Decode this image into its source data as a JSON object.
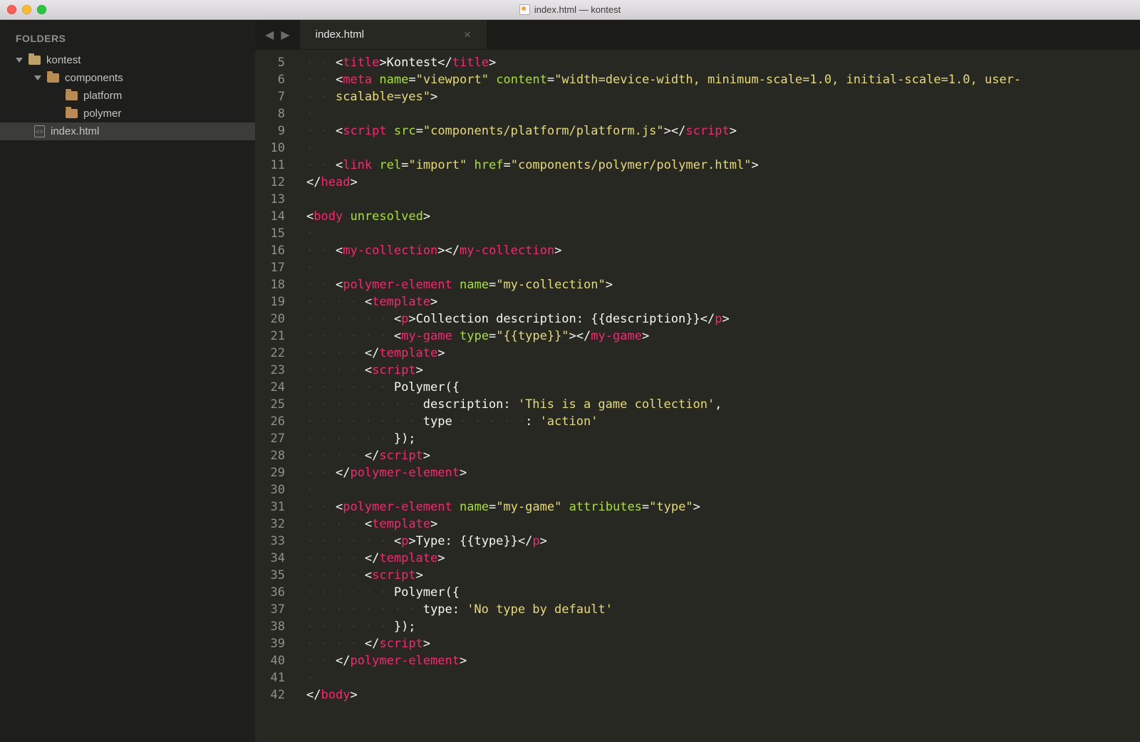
{
  "window": {
    "title": "index.html — kontest"
  },
  "sidebar": {
    "header": "FOLDERS",
    "tree": [
      {
        "level": 1,
        "type": "folder",
        "label": "kontest",
        "open": true
      },
      {
        "level": 2,
        "type": "folder",
        "label": "components",
        "open": true
      },
      {
        "level": 3,
        "type": "folder",
        "label": "platform"
      },
      {
        "level": 3,
        "type": "folder",
        "label": "polymer"
      },
      {
        "level": 2,
        "type": "file",
        "label": "index.html",
        "selected": true
      }
    ]
  },
  "tabs": {
    "active": "index.html",
    "close_glyph": "×",
    "prev": "◀",
    "next": "▶"
  },
  "gutter_start": 5,
  "gutter_end": 42,
  "code_lines": [
    [
      {
        "cls": "p",
        "t": "· · "
      },
      {
        "cls": "lt",
        "t": "<"
      },
      {
        "cls": "tag",
        "t": "title"
      },
      {
        "cls": "gt",
        "t": ">"
      },
      {
        "cls": "txt",
        "t": "Kontest"
      },
      {
        "cls": "lt",
        "t": "</"
      },
      {
        "cls": "tag",
        "t": "title"
      },
      {
        "cls": "gt",
        "t": ">"
      }
    ],
    [
      {
        "cls": "p",
        "t": "· · "
      },
      {
        "cls": "lt",
        "t": "<"
      },
      {
        "cls": "tag",
        "t": "meta"
      },
      {
        "cls": "txt",
        "t": " "
      },
      {
        "cls": "attr",
        "t": "name"
      },
      {
        "cls": "eq",
        "t": "="
      },
      {
        "cls": "str",
        "t": "\"viewport\""
      },
      {
        "cls": "txt",
        "t": " "
      },
      {
        "cls": "attr",
        "t": "content"
      },
      {
        "cls": "eq",
        "t": "="
      },
      {
        "cls": "str",
        "t": "\"width=device-width, minimum-scale=1.0, initial-scale=1.0, user-"
      }
    ],
    [
      {
        "cls": "p",
        "t": "· · "
      },
      {
        "cls": "str",
        "t": "scalable=yes\""
      },
      {
        "cls": "gt",
        "t": ">"
      }
    ],
    [
      {
        "cls": "p",
        "t": "·"
      }
    ],
    [
      {
        "cls": "p",
        "t": "· · "
      },
      {
        "cls": "lt",
        "t": "<"
      },
      {
        "cls": "tag",
        "t": "script"
      },
      {
        "cls": "txt",
        "t": " "
      },
      {
        "cls": "attr",
        "t": "src"
      },
      {
        "cls": "eq",
        "t": "="
      },
      {
        "cls": "str",
        "t": "\"components/platform/platform.js\""
      },
      {
        "cls": "gt",
        "t": ">"
      },
      {
        "cls": "lt",
        "t": "</"
      },
      {
        "cls": "tag",
        "t": "script"
      },
      {
        "cls": "gt",
        "t": ">"
      }
    ],
    [
      {
        "cls": "p",
        "t": "·"
      }
    ],
    [
      {
        "cls": "p",
        "t": "· · "
      },
      {
        "cls": "lt",
        "t": "<"
      },
      {
        "cls": "tag",
        "t": "link"
      },
      {
        "cls": "txt",
        "t": " "
      },
      {
        "cls": "attr",
        "t": "rel"
      },
      {
        "cls": "eq",
        "t": "="
      },
      {
        "cls": "str",
        "t": "\"import\""
      },
      {
        "cls": "txt",
        "t": " "
      },
      {
        "cls": "attr",
        "t": "href"
      },
      {
        "cls": "eq",
        "t": "="
      },
      {
        "cls": "str",
        "t": "\"components/polymer/polymer.html\""
      },
      {
        "cls": "gt",
        "t": ">"
      }
    ],
    [
      {
        "cls": "lt",
        "t": "</"
      },
      {
        "cls": "tag",
        "t": "head"
      },
      {
        "cls": "gt",
        "t": ">"
      }
    ],
    [
      {
        "cls": "txt",
        "t": ""
      }
    ],
    [
      {
        "cls": "lt",
        "t": "<"
      },
      {
        "cls": "tag",
        "t": "body"
      },
      {
        "cls": "txt",
        "t": " "
      },
      {
        "cls": "attr",
        "t": "unresolved"
      },
      {
        "cls": "gt",
        "t": ">"
      }
    ],
    [
      {
        "cls": "p",
        "t": "·"
      }
    ],
    [
      {
        "cls": "p",
        "t": "· · "
      },
      {
        "cls": "lt",
        "t": "<"
      },
      {
        "cls": "tag",
        "t": "my-collection"
      },
      {
        "cls": "gt",
        "t": ">"
      },
      {
        "cls": "lt",
        "t": "</"
      },
      {
        "cls": "tag",
        "t": "my-collection"
      },
      {
        "cls": "gt",
        "t": ">"
      }
    ],
    [
      {
        "cls": "p",
        "t": "·"
      }
    ],
    [
      {
        "cls": "p",
        "t": "· · "
      },
      {
        "cls": "lt",
        "t": "<"
      },
      {
        "cls": "tag",
        "t": "polymer-element"
      },
      {
        "cls": "txt",
        "t": " "
      },
      {
        "cls": "attr",
        "t": "name"
      },
      {
        "cls": "eq",
        "t": "="
      },
      {
        "cls": "str",
        "t": "\"my-collection\""
      },
      {
        "cls": "gt",
        "t": ">"
      }
    ],
    [
      {
        "cls": "p",
        "t": "· · · · "
      },
      {
        "cls": "lt",
        "t": "<"
      },
      {
        "cls": "tag",
        "t": "template"
      },
      {
        "cls": "gt",
        "t": ">"
      }
    ],
    [
      {
        "cls": "p",
        "t": "· · · · · · "
      },
      {
        "cls": "lt",
        "t": "<"
      },
      {
        "cls": "tag",
        "t": "p"
      },
      {
        "cls": "gt",
        "t": ">"
      },
      {
        "cls": "txt",
        "t": "Collection description: {{description}}"
      },
      {
        "cls": "lt",
        "t": "</"
      },
      {
        "cls": "tag",
        "t": "p"
      },
      {
        "cls": "gt",
        "t": ">"
      }
    ],
    [
      {
        "cls": "p",
        "t": "· · · · · · "
      },
      {
        "cls": "lt",
        "t": "<"
      },
      {
        "cls": "tag",
        "t": "my-game"
      },
      {
        "cls": "txt",
        "t": " "
      },
      {
        "cls": "attr",
        "t": "type"
      },
      {
        "cls": "eq",
        "t": "="
      },
      {
        "cls": "str",
        "t": "\"{{type}}\""
      },
      {
        "cls": "gt",
        "t": ">"
      },
      {
        "cls": "lt",
        "t": "</"
      },
      {
        "cls": "tag",
        "t": "my-game"
      },
      {
        "cls": "gt",
        "t": ">"
      }
    ],
    [
      {
        "cls": "p",
        "t": "· · · · "
      },
      {
        "cls": "lt",
        "t": "</"
      },
      {
        "cls": "tag",
        "t": "template"
      },
      {
        "cls": "gt",
        "t": ">"
      }
    ],
    [
      {
        "cls": "p",
        "t": "· · · · "
      },
      {
        "cls": "lt",
        "t": "<"
      },
      {
        "cls": "tag",
        "t": "script"
      },
      {
        "cls": "gt",
        "t": ">"
      }
    ],
    [
      {
        "cls": "p",
        "t": "· · · · · · "
      },
      {
        "cls": "txt",
        "t": "Polymer({"
      }
    ],
    [
      {
        "cls": "p",
        "t": "· · · · · · · · "
      },
      {
        "cls": "txt",
        "t": "description: "
      },
      {
        "cls": "str",
        "t": "'This is a game collection'"
      },
      {
        "cls": "txt",
        "t": ","
      }
    ],
    [
      {
        "cls": "p",
        "t": "· · · · · · · · "
      },
      {
        "cls": "txt",
        "t": "type"
      },
      {
        "cls": "p",
        "t": " · · · · ·"
      },
      {
        "cls": "txt",
        "t": ": "
      },
      {
        "cls": "str",
        "t": "'action'"
      }
    ],
    [
      {
        "cls": "p",
        "t": "· · · · · · "
      },
      {
        "cls": "txt",
        "t": "});"
      }
    ],
    [
      {
        "cls": "p",
        "t": "· · · · "
      },
      {
        "cls": "lt",
        "t": "</"
      },
      {
        "cls": "tag",
        "t": "script"
      },
      {
        "cls": "gt",
        "t": ">"
      }
    ],
    [
      {
        "cls": "p",
        "t": "· · "
      },
      {
        "cls": "lt",
        "t": "</"
      },
      {
        "cls": "tag",
        "t": "polymer-element"
      },
      {
        "cls": "gt",
        "t": ">"
      }
    ],
    [
      {
        "cls": "p",
        "t": "·"
      }
    ],
    [
      {
        "cls": "p",
        "t": "· · "
      },
      {
        "cls": "lt",
        "t": "<"
      },
      {
        "cls": "tag",
        "t": "polymer-element"
      },
      {
        "cls": "txt",
        "t": " "
      },
      {
        "cls": "attr",
        "t": "name"
      },
      {
        "cls": "eq",
        "t": "="
      },
      {
        "cls": "str",
        "t": "\"my-game\""
      },
      {
        "cls": "txt",
        "t": " "
      },
      {
        "cls": "attr",
        "t": "attributes"
      },
      {
        "cls": "eq",
        "t": "="
      },
      {
        "cls": "str",
        "t": "\"type\""
      },
      {
        "cls": "gt",
        "t": ">"
      }
    ],
    [
      {
        "cls": "p",
        "t": "· · · · "
      },
      {
        "cls": "lt",
        "t": "<"
      },
      {
        "cls": "tag",
        "t": "template"
      },
      {
        "cls": "gt",
        "t": ">"
      }
    ],
    [
      {
        "cls": "p",
        "t": "· · · · · · "
      },
      {
        "cls": "lt",
        "t": "<"
      },
      {
        "cls": "tag",
        "t": "p"
      },
      {
        "cls": "gt",
        "t": ">"
      },
      {
        "cls": "txt",
        "t": "Type: {{type}}"
      },
      {
        "cls": "lt",
        "t": "</"
      },
      {
        "cls": "tag",
        "t": "p"
      },
      {
        "cls": "gt",
        "t": ">"
      }
    ],
    [
      {
        "cls": "p",
        "t": "· · · · "
      },
      {
        "cls": "lt",
        "t": "</"
      },
      {
        "cls": "tag",
        "t": "template"
      },
      {
        "cls": "gt",
        "t": ">"
      }
    ],
    [
      {
        "cls": "p",
        "t": "· · · · "
      },
      {
        "cls": "lt",
        "t": "<"
      },
      {
        "cls": "tag",
        "t": "script"
      },
      {
        "cls": "gt",
        "t": ">"
      }
    ],
    [
      {
        "cls": "p",
        "t": "· · · · · · "
      },
      {
        "cls": "txt",
        "t": "Polymer({"
      }
    ],
    [
      {
        "cls": "p",
        "t": "· · · · · · · · "
      },
      {
        "cls": "txt",
        "t": "type: "
      },
      {
        "cls": "str",
        "t": "'No type by default'"
      }
    ],
    [
      {
        "cls": "p",
        "t": "· · · · · · "
      },
      {
        "cls": "txt",
        "t": "});"
      }
    ],
    [
      {
        "cls": "p",
        "t": "· · · · "
      },
      {
        "cls": "lt",
        "t": "</"
      },
      {
        "cls": "tag",
        "t": "script"
      },
      {
        "cls": "gt",
        "t": ">"
      }
    ],
    [
      {
        "cls": "p",
        "t": "· · "
      },
      {
        "cls": "lt",
        "t": "</"
      },
      {
        "cls": "tag",
        "t": "polymer-element"
      },
      {
        "cls": "gt",
        "t": ">"
      }
    ],
    [
      {
        "cls": "p",
        "t": "·"
      }
    ],
    [
      {
        "cls": "lt",
        "t": "</"
      },
      {
        "cls": "tag",
        "t": "body"
      },
      {
        "cls": "gt",
        "t": ">"
      }
    ],
    [
      {
        "cls": "txt",
        "t": ""
      }
    ]
  ]
}
